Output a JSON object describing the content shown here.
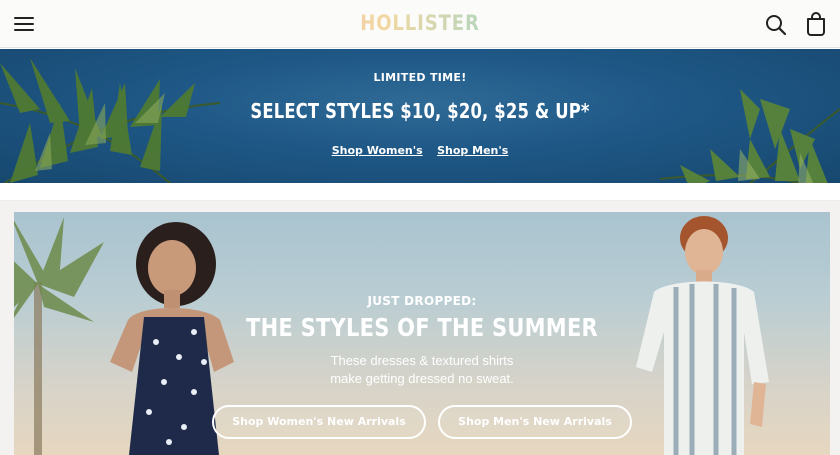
{
  "header": {
    "logo_text": "HOLLISTER",
    "icons": {
      "menu": "hamburger-menu-icon",
      "search": "search-icon",
      "bag": "shopping-bag-icon"
    }
  },
  "promo": {
    "kicker": "LIMITED TIME!",
    "headline": "SELECT STYLES $10, $20, $25 & UP*",
    "links": [
      "Shop Women's",
      "Shop Men's"
    ],
    "background_color": "#1e5785"
  },
  "hero": {
    "kicker": "JUST DROPPED:",
    "title": "THE STYLES OF THE SUMMER",
    "subtitle_lines": [
      "These dresses & textured shirts",
      "make getting dressed no sweat."
    ],
    "buttons": [
      "Shop Women's New Arrivals",
      "Shop Men's New Arrivals"
    ]
  }
}
